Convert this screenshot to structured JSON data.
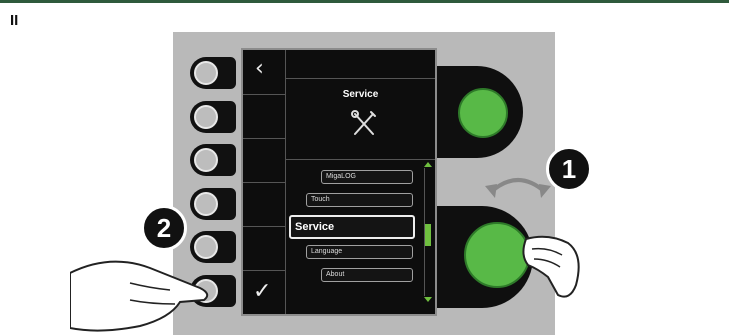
{
  "section_label": "II",
  "screen": {
    "title": "Service",
    "title_icon": "tools-icon",
    "back_icon": "chevron-left-icon",
    "confirm_icon": "checkmark-icon",
    "menu_items": [
      "MigaLOG",
      "Touch",
      "Service",
      "Language",
      "About"
    ],
    "selected_item": "Service"
  },
  "callouts": {
    "rotate_knob_step": "1",
    "press_button_step": "2"
  },
  "colors": {
    "knob": "#58b947",
    "scroll_accent": "#6fbf3f",
    "panel": "#b9b9b9",
    "top_rule": "#2f5a3c"
  }
}
